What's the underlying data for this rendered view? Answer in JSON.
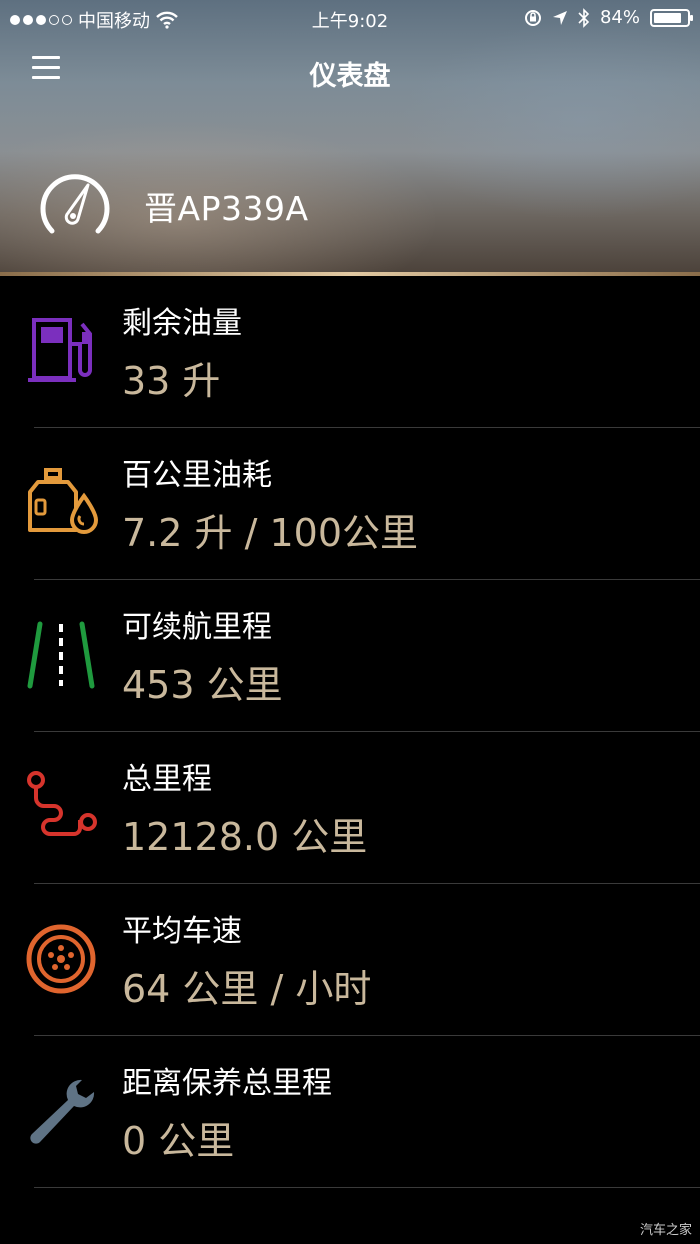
{
  "status_bar": {
    "carrier": "中国移动",
    "time": "上午9:02",
    "battery": "84%",
    "battery_level": 0.84
  },
  "nav": {
    "title": "仪表盘"
  },
  "vehicle": {
    "plate": "晋AP339A"
  },
  "metrics": [
    {
      "label": "剩余油量",
      "value": "33 升",
      "icon": "fuel-pump-icon",
      "color": "#7b2fbe"
    },
    {
      "label": "百公里油耗",
      "value": "7.2 升 / 100公里",
      "icon": "oil-can-icon",
      "color": "#e39a3c"
    },
    {
      "label": "可续航里程",
      "value": "453 公里",
      "icon": "road-icon",
      "color": "#1f9a3e"
    },
    {
      "label": "总里程",
      "value": "12128.0 公里",
      "icon": "route-icon",
      "color": "#d6342c"
    },
    {
      "label": "平均车速",
      "value": "64 公里 / 小时",
      "icon": "wheel-icon",
      "color": "#e0652e"
    },
    {
      "label": "距离保养总里程",
      "value": "0 公里",
      "icon": "wrench-icon",
      "color": "#5f7385"
    }
  ],
  "watermark": "汽车之家"
}
